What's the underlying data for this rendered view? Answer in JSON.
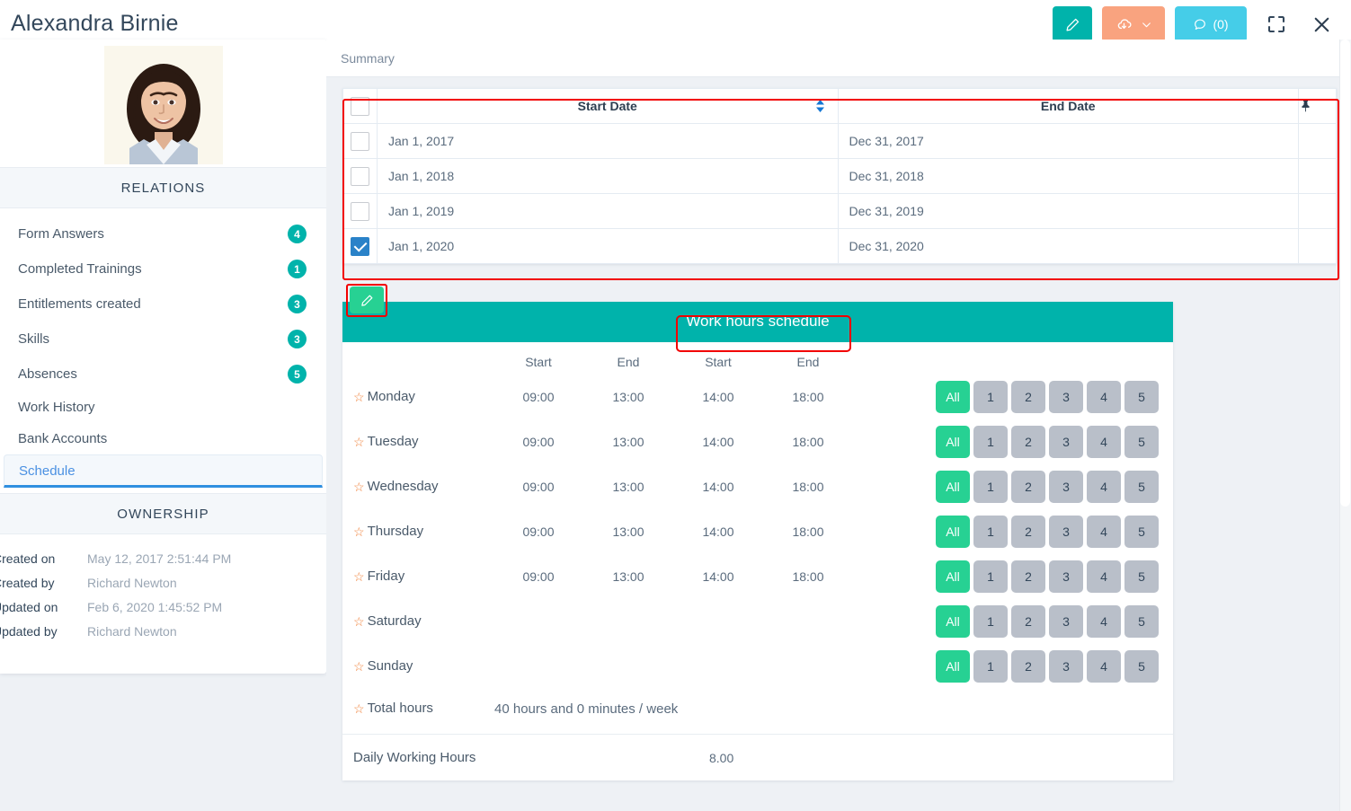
{
  "header": {
    "title": "Alexandra Birnie",
    "buttons": {
      "edit": "edit-pencil",
      "export": "cloud-download",
      "export_caret": "chevron-down",
      "comment_label": "(0)",
      "fullscreen": "fullscreen",
      "close": "close"
    }
  },
  "sidebar": {
    "avatar_alt": "Alexandra Birnie photo",
    "relations_title": "RELATIONS",
    "items": [
      {
        "label": "Form Answers",
        "badge": "4",
        "active": false
      },
      {
        "label": "Completed Trainings",
        "badge": "1",
        "active": false
      },
      {
        "label": "Entitlements created",
        "badge": "3",
        "active": false
      },
      {
        "label": "Skills",
        "badge": "3",
        "active": false
      },
      {
        "label": "Absences",
        "badge": "5",
        "active": false
      },
      {
        "label": "Work History",
        "badge": "",
        "active": false
      },
      {
        "label": "Bank Accounts",
        "badge": "",
        "active": false
      },
      {
        "label": "Schedule",
        "badge": "",
        "active": true
      }
    ],
    "ownership_title": "OWNERSHIP",
    "ownership": [
      {
        "key": "Created on",
        "value": "May 12, 2017 2:51:44 PM"
      },
      {
        "key": "Created by",
        "value": "Richard Newton"
      },
      {
        "key": "Updated on",
        "value": "Feb 6, 2020 1:45:52 PM"
      },
      {
        "key": "Updated by",
        "value": "Richard Newton"
      }
    ]
  },
  "main": {
    "tabs": [
      {
        "label": "Summary",
        "active": true
      }
    ],
    "grid": {
      "columns": [
        "Start Date",
        "End Date"
      ],
      "pin_icon": "pin-icon",
      "sort_icon": "sort-icon",
      "rows": [
        {
          "start": "Jan 1, 2017",
          "end": "Dec 31, 2017",
          "checked": false
        },
        {
          "start": "Jan 1, 2018",
          "end": "Dec 31, 2018",
          "checked": false
        },
        {
          "start": "Jan 1, 2019",
          "end": "Dec 31, 2019",
          "checked": false
        },
        {
          "start": "Jan 1, 2020",
          "end": "Dec 31, 2020",
          "checked": true
        }
      ]
    },
    "row_edit_button": "edit-pencil",
    "schedule": {
      "title": "Work hours schedule",
      "col_headers": [
        "Start",
        "End",
        "Start",
        "End"
      ],
      "rows": [
        {
          "day": "Monday",
          "t1": "09:00",
          "t2": "13:00",
          "t3": "14:00",
          "t4": "18:00"
        },
        {
          "day": "Tuesday",
          "t1": "09:00",
          "t2": "13:00",
          "t3": "14:00",
          "t4": "18:00"
        },
        {
          "day": "Wednesday",
          "t1": "09:00",
          "t2": "13:00",
          "t3": "14:00",
          "t4": "18:00"
        },
        {
          "day": "Thursday",
          "t1": "09:00",
          "t2": "13:00",
          "t3": "14:00",
          "t4": "18:00"
        },
        {
          "day": "Friday",
          "t1": "09:00",
          "t2": "13:00",
          "t3": "14:00",
          "t4": "18:00"
        },
        {
          "day": "Saturday",
          "t1": "",
          "t2": "",
          "t3": "",
          "t4": ""
        },
        {
          "day": "Sunday",
          "t1": "",
          "t2": "",
          "t3": "",
          "t4": ""
        }
      ],
      "week_buttons": [
        "All",
        "1",
        "2",
        "3",
        "4",
        "5"
      ],
      "total_label": "Total hours",
      "total_value": "40 hours and 0 minutes / week",
      "daily_label": "Daily Working Hours",
      "daily_value": "8.00"
    }
  },
  "colors": {
    "teal": "#00b3ab",
    "orange": "#f9a37f",
    "cyan": "#45cde8",
    "green": "#27d193",
    "grey_btn": "#b9bfc9",
    "checkbox_blue": "#2a82c8",
    "star_orange": "#f0823c",
    "annotation_red": "#f20000",
    "active_blue": "#4a90e2"
  }
}
